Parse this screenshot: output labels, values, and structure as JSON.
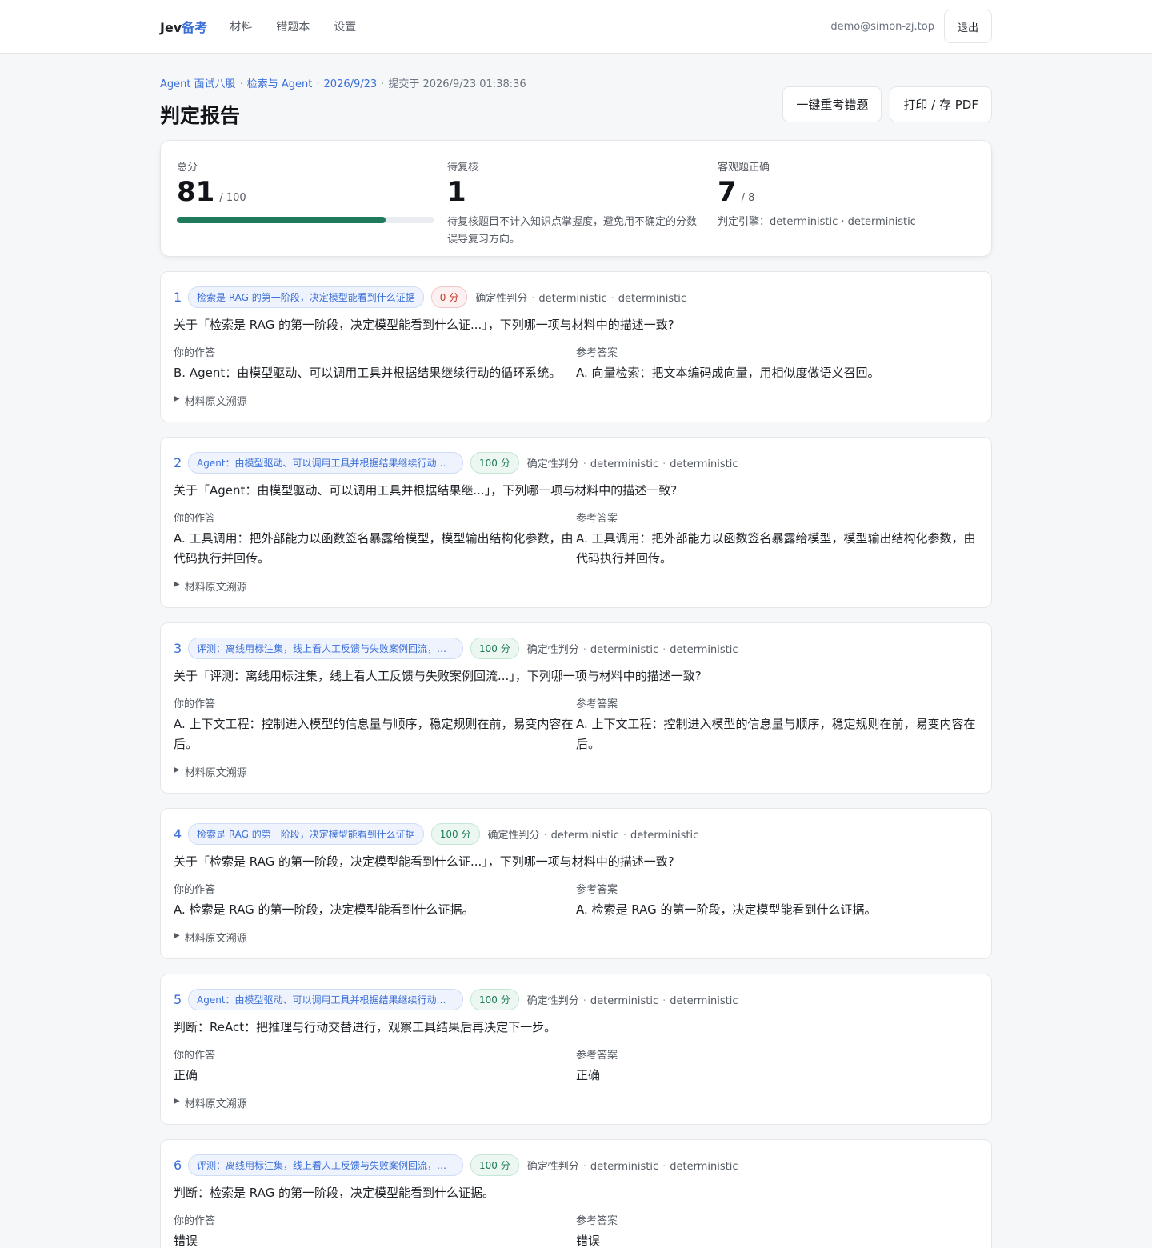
{
  "nav": {
    "brand_a": "Jev",
    "brand_b": "备考",
    "links": [
      "材料",
      "错题本",
      "设置"
    ],
    "email": "demo@simon-zj.top",
    "logout": "退出"
  },
  "header": {
    "crumb_1": "Agent 面试八股",
    "crumb_2": "检索与 Agent",
    "crumb_3": "2026/9/23",
    "crumb_4": "提交于 2026/9/23 01:38:36",
    "title": "判定报告",
    "retry_btn": "一键重考错题",
    "print_btn": "打印 / 存 PDF"
  },
  "summary": {
    "total_label": "总分",
    "total_value": "81",
    "total_max": "/ 100",
    "progress_pct": 81,
    "pending_label": "待复核",
    "pending_value": "1",
    "pending_note": "待复核题目不计入知识点掌握度，避免用不确定的分数误导复习方向。",
    "objective_label": "客观题正确",
    "objective_value": "7",
    "objective_max": "/ 8",
    "engine_note": "判定引擎：deterministic · deterministic"
  },
  "labels": {
    "your_answer": "你的作答",
    "reference": "参考答案",
    "trace": "材料原文溯源",
    "meta_a": "确定性判分",
    "meta_b": "deterministic",
    "meta_c": "deterministic"
  },
  "questions": [
    {
      "num": "1",
      "topic": "检索是 RAG 的第一阶段，决定模型能看到什么证据",
      "score": "0 分",
      "status": "bad",
      "text": "关于「检索是 RAG 的第一阶段，决定模型能看到什么证...」，下列哪一项与材料中的描述一致?",
      "answer": "B. Agent：由模型驱动、可以调用工具并根据结果继续行动的循环系统。",
      "reference": "A. 向量检索：把文本编码成向量，用相似度做语义召回。"
    },
    {
      "num": "2",
      "topic": "Agent：由模型驱动、可以调用工具并根据结果继续行动的循环系统",
      "score": "100 分",
      "status": "good",
      "text": "关于「Agent：由模型驱动、可以调用工具并根据结果继...」，下列哪一项与材料中的描述一致?",
      "answer": "A. 工具调用：把外部能力以函数签名暴露给模型，模型输出结构化参数，由代码执行并回传。",
      "reference": "A. 工具调用：把外部能力以函数签名暴露给模型，模型输出结构化参数，由代码执行并回传。"
    },
    {
      "num": "3",
      "topic": "评测：离线用标注集，线上看人工反馈与失败案例回流，没有评测就无从优化",
      "score": "100 分",
      "status": "good",
      "text": "关于「评测：离线用标注集，线上看人工反馈与失败案例回流...」，下列哪一项与材料中的描述一致?",
      "answer": "A. 上下文工程：控制进入模型的信息量与顺序，稳定规则在前，易变内容在后。",
      "reference": "A. 上下文工程：控制进入模型的信息量与顺序，稳定规则在前，易变内容在后。"
    },
    {
      "num": "4",
      "topic": "检索是 RAG 的第一阶段，决定模型能看到什么证据",
      "score": "100 分",
      "status": "good",
      "text": "关于「检索是 RAG 的第一阶段，决定模型能看到什么证...」，下列哪一项与材料中的描述一致?",
      "answer": "A. 检索是 RAG 的第一阶段，决定模型能看到什么证据。",
      "reference": "A. 检索是 RAG 的第一阶段，决定模型能看到什么证据。"
    },
    {
      "num": "5",
      "topic": "Agent：由模型驱动、可以调用工具并根据结果继续行动的循环系统",
      "score": "100 分",
      "status": "good",
      "text": "判断：ReAct：把推理与行动交替进行，观察工具结果后再决定下一步。",
      "answer": "正确",
      "reference": "正确"
    },
    {
      "num": "6",
      "topic": "评测：离线用标注集，线上看人工反馈与失败案例回流，没有评测就无从优化",
      "score": "100 分",
      "status": "good",
      "text": "判断：检索是 RAG 的第一阶段，决定模型能看到什么证据。",
      "answer": "错误",
      "reference": "错误"
    }
  ]
}
